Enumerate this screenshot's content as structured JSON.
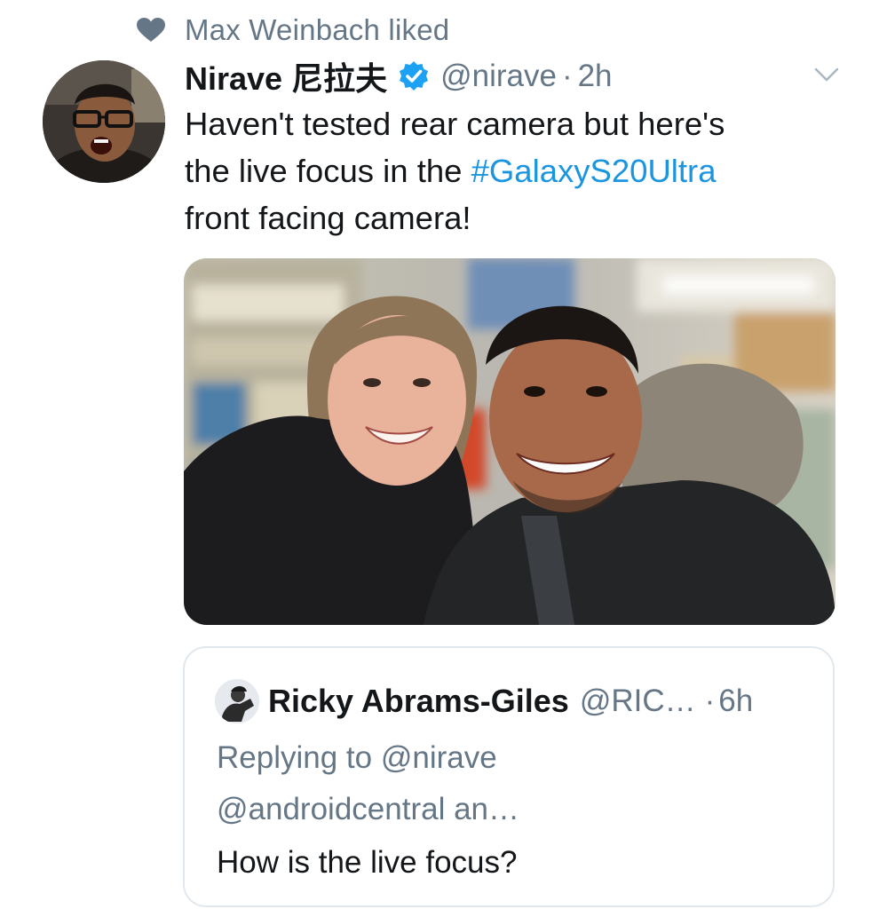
{
  "context": {
    "icon": "heart-icon",
    "text": "Max Weinbach liked"
  },
  "tweet": {
    "author_name": "Nirave 尼拉夫",
    "handle": "@nirave",
    "separator": "·",
    "time": "2h",
    "verified_icon": "verified-badge-icon",
    "menu_icon": "chevron-down-icon",
    "text_lines": {
      "line1": "Haven't tested rear camera but here's",
      "line2_pre": "the live focus in the ",
      "hashtag": "#GalaxyS20Ultra",
      "line3": "front facing camera!"
    },
    "media_alt": "photo"
  },
  "quote": {
    "author_name": "Ricky Abrams-Giles",
    "handle": "@RIC…",
    "separator": "·",
    "time": "6h",
    "replying_line1": "Replying to @nirave",
    "replying_line2": "@androidcentral an…",
    "body": "How is the live focus?"
  },
  "colors": {
    "secondary_text": "#657786",
    "link": "#1b95e0",
    "verified": "#1da1f2",
    "border": "#e1e8ed"
  }
}
